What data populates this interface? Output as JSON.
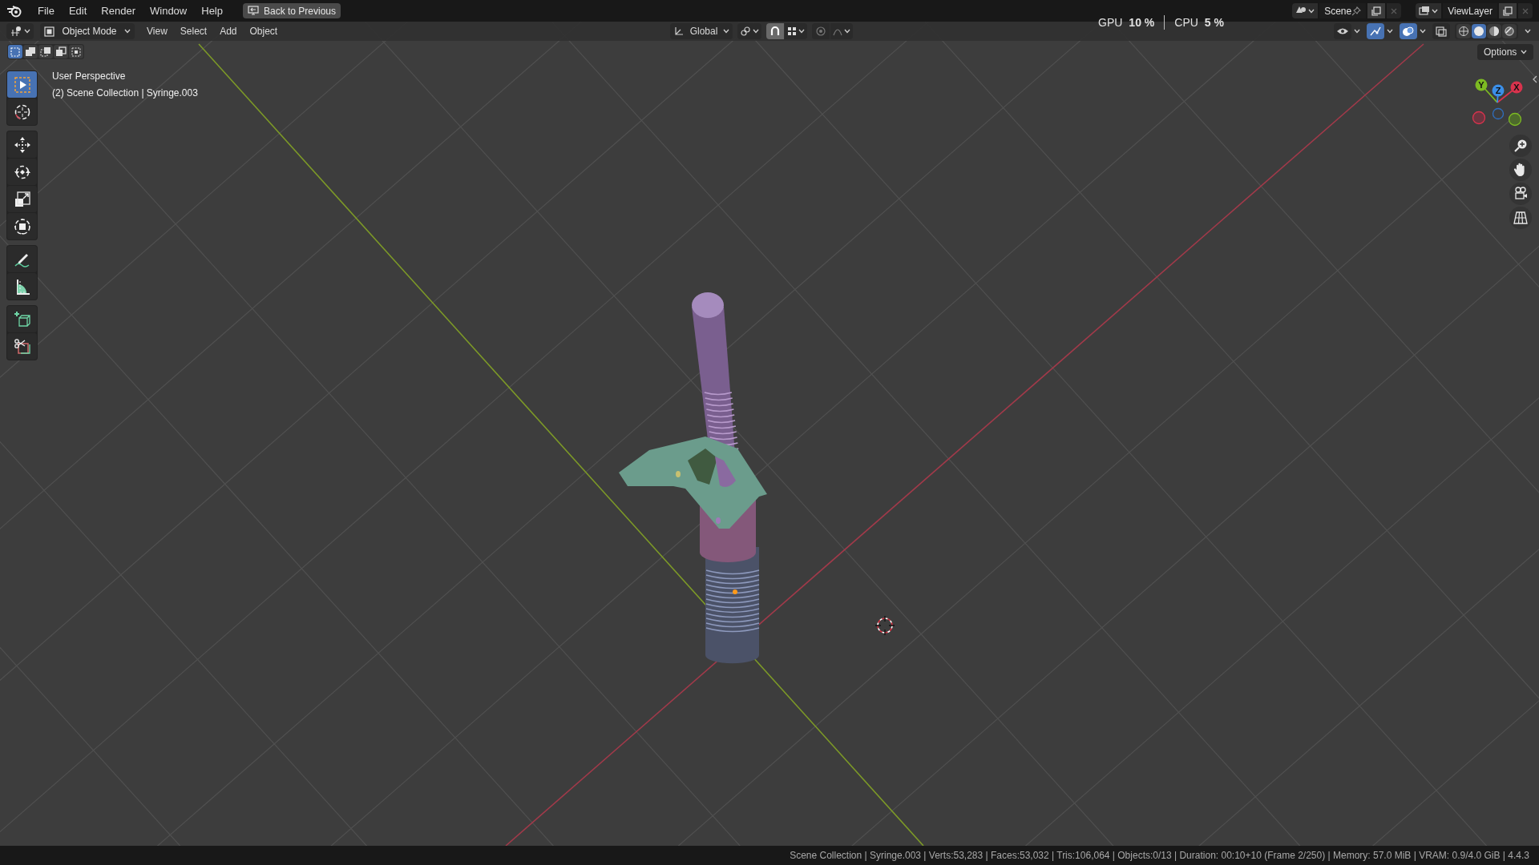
{
  "menu_bar": {
    "items": [
      "File",
      "Edit",
      "Render",
      "Window",
      "Help"
    ],
    "back_button": "Back to Previous"
  },
  "stats": {
    "gpu_label": "GPU",
    "gpu_value": "10 %",
    "cpu_label": "CPU",
    "cpu_value": "5 %"
  },
  "scene": {
    "value": "Scene"
  },
  "view_layer": {
    "value": "ViewLayer"
  },
  "header": {
    "mode": "Object Mode",
    "menus": [
      "View",
      "Select",
      "Add",
      "Object"
    ],
    "orientation": "Global",
    "toggles": [
      {
        "kind": "snap",
        "active": true
      },
      {
        "kind": "proportional",
        "active": false
      }
    ],
    "view_toggles": [
      {
        "kind": "visibility",
        "active": false
      },
      {
        "kind": "gizmos",
        "active": true
      },
      {
        "kind": "overlays",
        "active": true
      },
      {
        "kind": "xray",
        "active": false
      }
    ],
    "shading": [
      {
        "kind": "wireframe",
        "selected": false
      },
      {
        "kind": "solid",
        "selected": true
      },
      {
        "kind": "material",
        "selected": false
      },
      {
        "kind": "rendered",
        "selected": false
      }
    ]
  },
  "select_modes": [
    {
      "kind": "new",
      "selected": true
    },
    {
      "kind": "extend",
      "selected": false
    },
    {
      "kind": "subtract",
      "selected": false
    },
    {
      "kind": "invert",
      "selected": false
    },
    {
      "kind": "intersect",
      "selected": false
    }
  ],
  "options": "Options",
  "tool_groups": [
    [
      {
        "kind": "select_box",
        "selected": true
      },
      {
        "kind": "cursor",
        "selected": false
      }
    ],
    [
      {
        "kind": "move",
        "selected": false
      },
      {
        "kind": "rotate",
        "selected": false
      },
      {
        "kind": "scale",
        "selected": false
      },
      {
        "kind": "transform",
        "selected": false
      }
    ],
    [
      {
        "kind": "annotate",
        "selected": false
      },
      {
        "kind": "measure",
        "selected": false
      }
    ],
    [
      {
        "kind": "add_cube",
        "selected": false
      },
      {
        "kind": "cut",
        "selected": false
      }
    ]
  ],
  "viewport_info": [
    "User Perspective",
    "(2) Scene Collection | Syringe.003"
  ],
  "gizmo": {
    "x": "X",
    "y": "Y",
    "z": "Z"
  },
  "navigation": [
    {
      "kind": "zoom"
    },
    {
      "kind": "pan"
    },
    {
      "kind": "camera"
    },
    {
      "kind": "perspective"
    }
  ],
  "status_bar": "Scene Collection | Syringe.003 | Verts:53,283 | Faces:53,032 | Tris:106,064 | Objects:0/13 | Duration: 00:10+10 (Frame 2/250) | Memory: 57.0 MiB | VRAM: 0.9/4.0 GiB | 4.4.3"
}
